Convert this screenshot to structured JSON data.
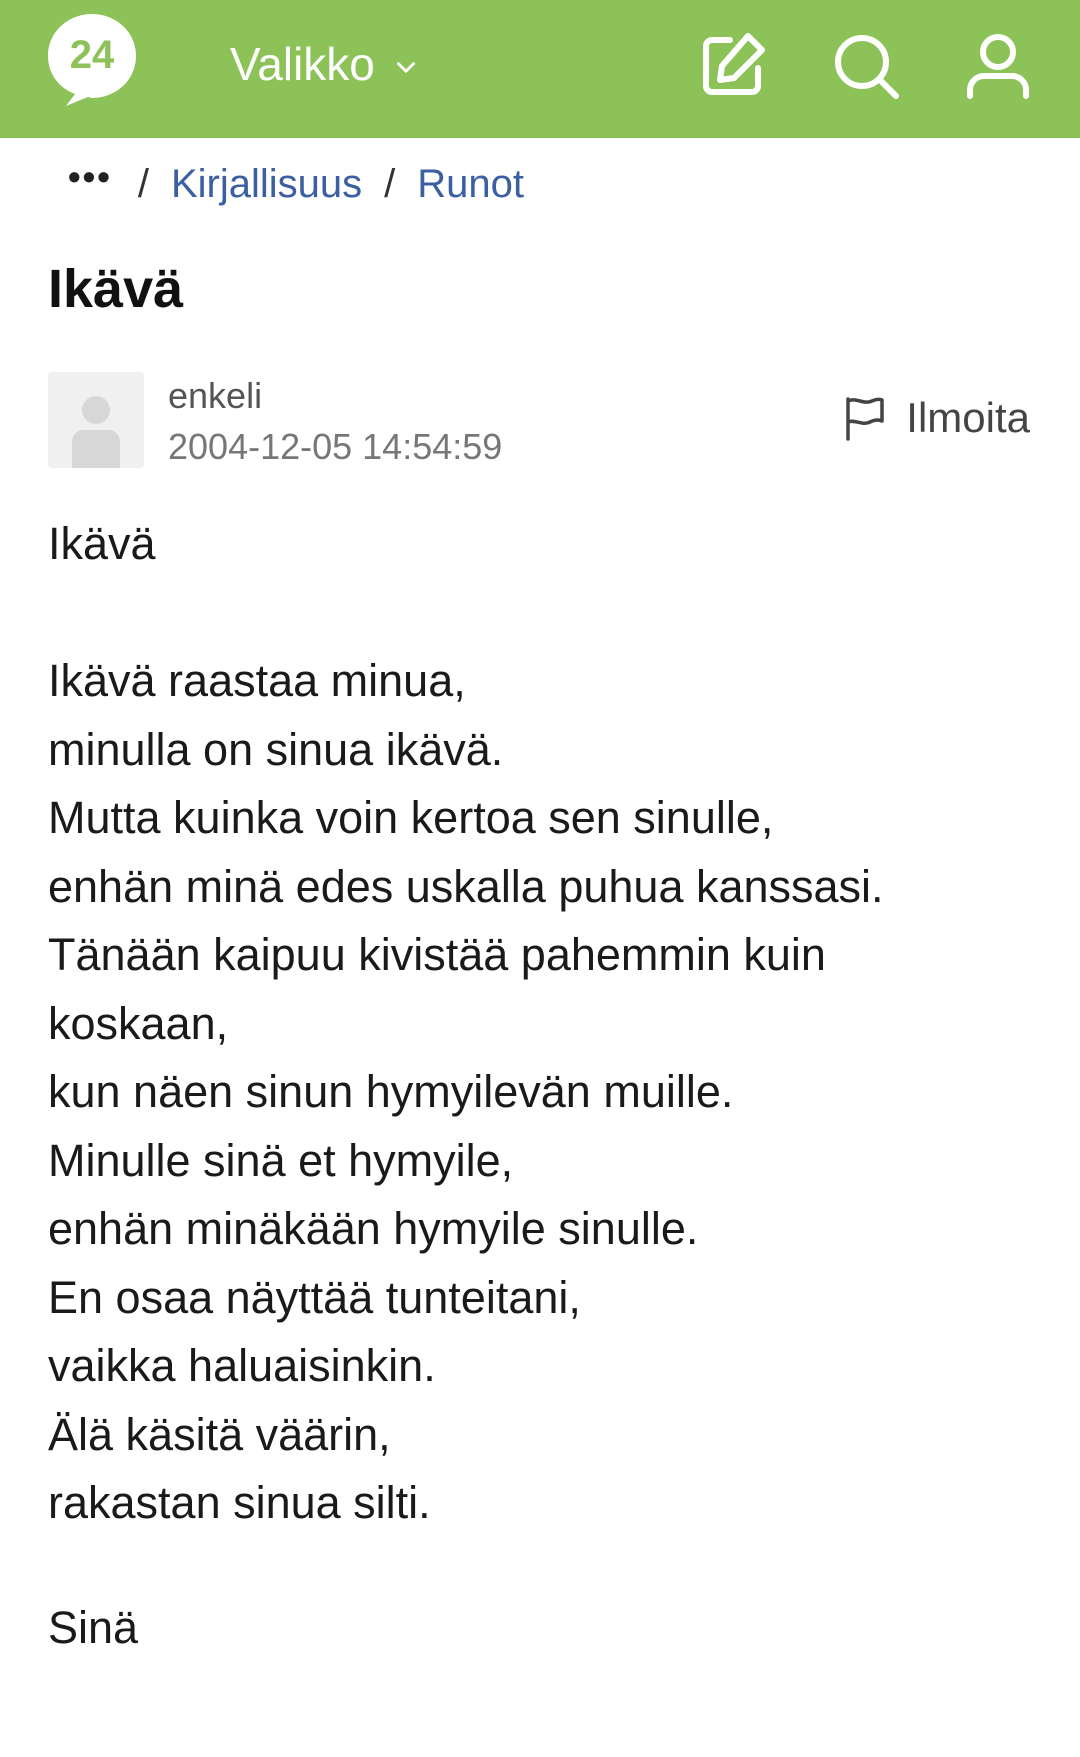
{
  "header": {
    "logo_text": "24",
    "menu_label": "Valikko",
    "icons": [
      "edit-icon",
      "search-icon",
      "user-icon"
    ]
  },
  "breadcrumb": {
    "more": "•••",
    "items": [
      "Kirjallisuus",
      "Runot"
    ]
  },
  "post": {
    "title": "Ikävä",
    "author": "enkeli",
    "timestamp": "2004-12-05 14:54:59",
    "report_label": "Ilmoita",
    "lines": [
      "Ikävä",
      "",
      "Ikävä raastaa minua,",
      "minulla on sinua ikävä.",
      "Mutta kuinka voin kertoa sen sinulle,",
      "enhän minä edes uskalla puhua kanssasi.",
      "Tänään kaipuu kivistää pahemmin kuin",
      "koskaan,",
      "kun näen sinun hymyilevän muille.",
      "Minulle sinä et hymyile,",
      "enhän minäkään hymyile sinulle.",
      "En osaa näyttää tunteitani,",
      "vaikka haluaisinkin.",
      "Älä käsitä väärin,",
      "rakastan sinua silti."
    ],
    "signature": "Sinä"
  },
  "colors": {
    "header_bg": "#8cc257",
    "link": "#3b5fa0",
    "text": "#1a1a1a",
    "muted": "#777777"
  }
}
